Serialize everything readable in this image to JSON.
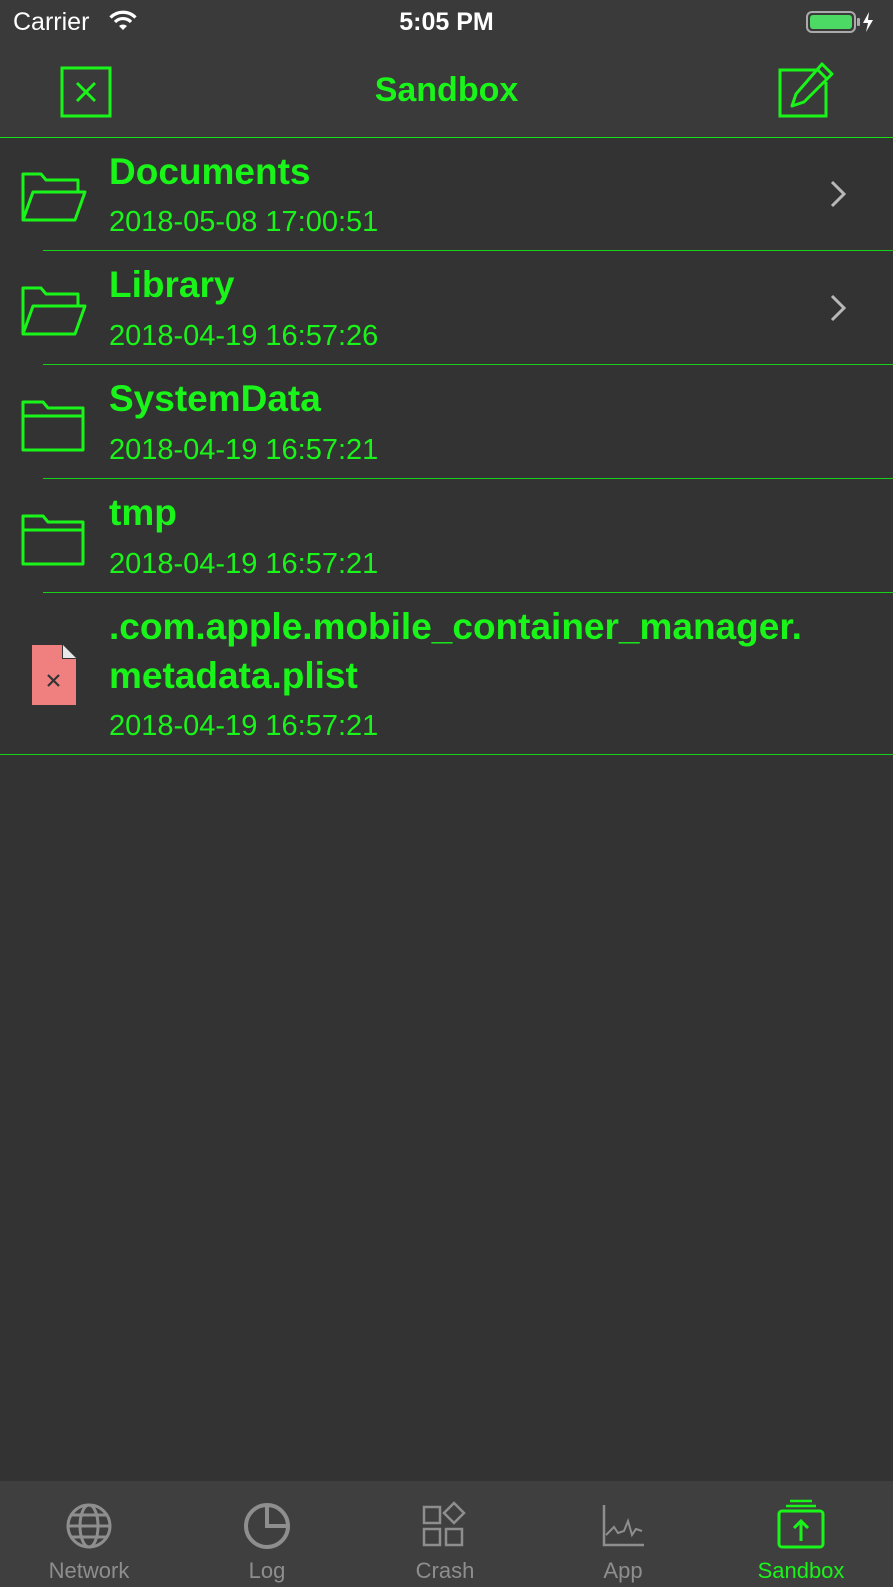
{
  "status_bar": {
    "carrier": "Carrier",
    "time": "5:05 PM"
  },
  "nav": {
    "title": "Sandbox",
    "left_icon": "close-icon",
    "right_icon": "edit-icon"
  },
  "items": [
    {
      "name": "Documents",
      "date": "2018-05-08 17:00:51",
      "icon": "folder-open-icon",
      "has_chevron": true
    },
    {
      "name": "Library",
      "date": "2018-04-19 16:57:26",
      "icon": "folder-open-icon",
      "has_chevron": true
    },
    {
      "name": "SystemData",
      "date": "2018-04-19 16:57:21",
      "icon": "folder-icon",
      "has_chevron": false
    },
    {
      "name": "tmp",
      "date": "2018-04-19 16:57:21",
      "icon": "folder-icon",
      "has_chevron": false
    },
    {
      "name_line1": ".com.apple.mobile_container_manager.",
      "name_line2": "metadata.plist",
      "date": "2018-04-19 16:57:21",
      "icon": "file-error-icon",
      "has_chevron": false
    }
  ],
  "tabs": [
    {
      "label": "Network",
      "icon": "globe-icon",
      "active": false
    },
    {
      "label": "Log",
      "icon": "pie-icon",
      "active": false
    },
    {
      "label": "Crash",
      "icon": "shapes-icon",
      "active": false
    },
    {
      "label": "App",
      "icon": "chart-icon",
      "active": false
    },
    {
      "label": "Sandbox",
      "icon": "upload-icon",
      "active": true
    }
  ],
  "colors": {
    "accent": "#19f519",
    "background": "#333333",
    "bar": "#3a3a3a",
    "inactive": "#8e8e8e"
  }
}
